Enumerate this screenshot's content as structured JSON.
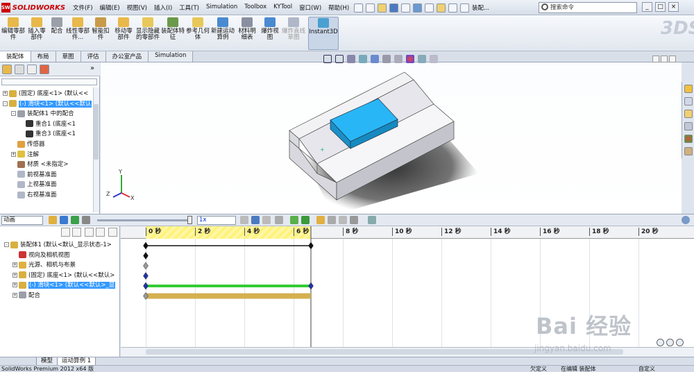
{
  "app": {
    "logo_text": "SOLIDWORKS",
    "logo_badge": "SW"
  },
  "menus": [
    "文件(F)",
    "编辑(E)",
    "视图(V)",
    "插入(I)",
    "工具(T)",
    "Simulation",
    "Toolbox",
    "KYTool",
    "窗口(W)",
    "帮助(H)"
  ],
  "title_fragment": "装配...",
  "search": {
    "placeholder": "搜索命令"
  },
  "window_buttons": [
    "_",
    "□",
    "×"
  ],
  "commands": [
    {
      "label": "编辑零部件",
      "icon": "edit-component-icon",
      "color": "#e8b84a"
    },
    {
      "label": "插入零部件",
      "icon": "insert-component-icon",
      "color": "#e8b84a"
    },
    {
      "label": "配合",
      "icon": "mate-icon",
      "color": "#9a9fa8"
    },
    {
      "label": "线性零部件...",
      "icon": "linear-pattern-icon",
      "color": "#e8b84a"
    },
    {
      "label": "智能扣件",
      "icon": "smart-fastener-icon",
      "color": "#c89a4a"
    },
    {
      "label": "移动零部件",
      "icon": "move-component-icon",
      "color": "#e8b84a"
    },
    {
      "label": "显示隐藏的零部件",
      "icon": "show-hidden-icon",
      "color": "#e8c85a"
    },
    {
      "label": "装配体特征",
      "icon": "assembly-feature-icon",
      "color": "#6a9a4a"
    },
    {
      "label": "参考几何体",
      "icon": "reference-geometry-icon",
      "color": "#e8c85a"
    },
    {
      "label": "新建运动算例",
      "icon": "new-motion-study-icon",
      "color": "#4a8ad0"
    },
    {
      "label": "材料明细表",
      "icon": "bom-icon",
      "color": "#8a8fa0"
    },
    {
      "label": "爆炸视图",
      "icon": "exploded-view-icon",
      "color": "#4a8ad0"
    },
    {
      "label": "爆炸直线草图",
      "icon": "explode-line-sketch-icon",
      "color": "#b0b8c8"
    },
    {
      "label": "Instant3D",
      "icon": "instant3d-icon",
      "color": "#4aa0d0"
    }
  ],
  "tabs": [
    "装配体",
    "布局",
    "草图",
    "评估",
    "办公室产品",
    "Simulation"
  ],
  "feature_tree": [
    {
      "label": "(固定) 底座<1> (默认<<",
      "expander": "+",
      "icon_color": "#d8b040",
      "indent": 0
    },
    {
      "label": "(-) 滑块<1> (默认<<默认",
      "expander": "-",
      "icon_color": "#d8b040",
      "indent": 0,
      "selected": true
    },
    {
      "label": "装配体1 中的配合",
      "expander": "-",
      "icon_color": "#9a9fa8",
      "indent": 1
    },
    {
      "label": "重合1 (底座<1",
      "expander": "",
      "icon_color": "#333333",
      "indent": 2
    },
    {
      "label": "重合3 (底座<1",
      "expander": "",
      "icon_color": "#333333",
      "indent": 2
    },
    {
      "label": "传感器",
      "expander": "",
      "icon_color": "#e0a040",
      "indent": 1
    },
    {
      "label": "注解",
      "expander": "+",
      "icon_color": "#e0c040",
      "indent": 1
    },
    {
      "label": "材质 <未指定>",
      "expander": "",
      "icon_color": "#a07050",
      "indent": 1
    },
    {
      "label": "前视基准面",
      "expander": "",
      "icon_color": "#b0b8c8",
      "indent": 1
    },
    {
      "label": "上视基准面",
      "expander": "",
      "icon_color": "#b0b8c8",
      "indent": 1
    },
    {
      "label": "右视基准面",
      "expander": "",
      "icon_color": "#b0b8c8",
      "indent": 1
    }
  ],
  "motion": {
    "study_type": "动画",
    "speed": "1x",
    "tree": [
      {
        "label": "装配体1 (默认<默认_显示状态-1>",
        "expander": "-",
        "icon_color": "#d8b040"
      },
      {
        "label": "视向及相机视图",
        "expander": "",
        "icon_color": "#cc3333"
      },
      {
        "label": "光源、相机与布景",
        "expander": "+",
        "icon_color": "#e0b040"
      },
      {
        "label": "(固定) 底座<1> (默认<<默认>",
        "expander": "+",
        "icon_color": "#d8b040"
      },
      {
        "label": "(-) 滑块<1> (默认<<默认>_显",
        "expander": "+",
        "icon_color": "#d8b040",
        "selected": true
      },
      {
        "label": "配合",
        "expander": "+",
        "icon_color": "#9a9fa8"
      }
    ],
    "ruler_labels": [
      "0 秒",
      "2 秒",
      "4 秒",
      "6 秒",
      "8 秒",
      "10 秒",
      "12 秒",
      "14 秒",
      "16 秒",
      "18 秒",
      "20 秒"
    ]
  },
  "bottom_tabs": [
    "模型",
    "运动算例 1"
  ],
  "status": {
    "left": "SolidWorks Premium 2012 x64 版",
    "undefined": "欠定义",
    "editing": "在编辑 装配体",
    "custom": "自定义"
  },
  "watermark": {
    "brand": "Bai 经验",
    "url": "jingyan.baidu.com"
  },
  "colors": {
    "accent": "#3399ff",
    "slider_top": "#29b6f6",
    "timeline_green": "#33cc33",
    "timeline_gold": "#d4b050",
    "ruler_yellow": "#fff27a"
  }
}
